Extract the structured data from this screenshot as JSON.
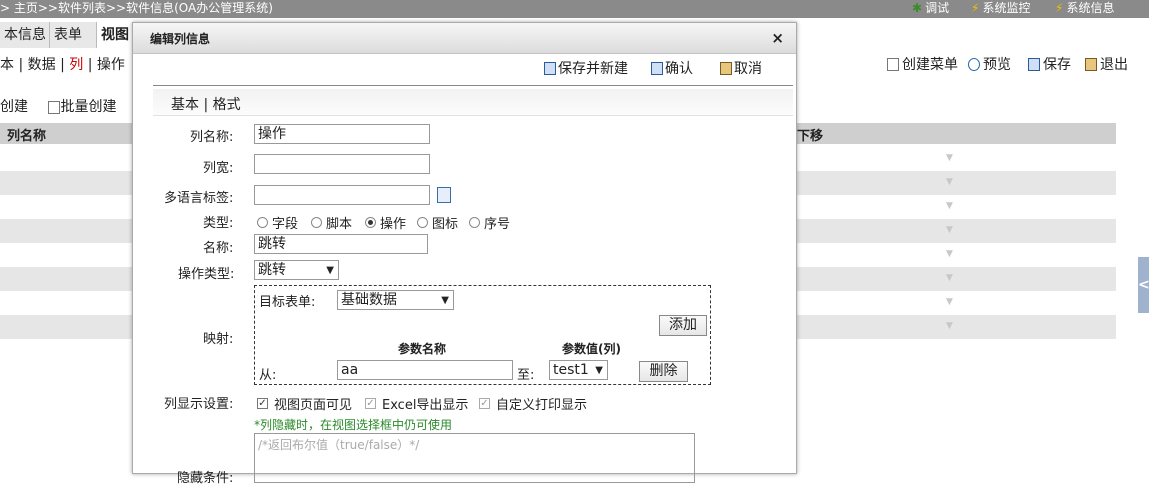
{
  "topbar": {
    "breadcrumb": "> 主页>>软件列表>>软件信息(OA办公管理系统)",
    "tools": [
      "调试",
      "系统监控",
      "系统信息"
    ]
  },
  "tabs": [
    "本信息",
    "表单",
    "视图"
  ],
  "subnav": {
    "a": "本",
    "b": "数据",
    "c": "列",
    "d": "操作"
  },
  "right_toolbar": [
    "创建菜单",
    "预览",
    "保存",
    "退出"
  ],
  "creates": {
    "single": "创建",
    "batch": "批量创建"
  },
  "grid": {
    "col_name": "列名称",
    "col_down": "下移",
    "row_count": 8
  },
  "modal": {
    "title": "编辑列信息",
    "close": "×",
    "buttons": {
      "save_new": "保存并新建",
      "confirm": "确认",
      "cancel": "取消"
    },
    "section": "基本 | 格式",
    "labels": {
      "col_name": "列名称:",
      "col_width": "列宽:",
      "lang_tag": "多语言标签:",
      "type": "类型:",
      "name": "名称:",
      "op_type": "操作类型:",
      "mapping": "映射:",
      "display": "列显示设置:",
      "hide_cond": "隐藏条件:"
    },
    "values": {
      "col_name": "操作",
      "col_width": "",
      "lang_tag": "",
      "name": "跳转",
      "op_type": "跳转"
    },
    "type_options": [
      "字段",
      "脚本",
      "操作",
      "图标",
      "序号"
    ],
    "type_selected": 2,
    "mapping": {
      "target_label": "目标表单:",
      "target_value": "基础数据",
      "add": "添加",
      "param_name_header": "参数名称",
      "param_value_header": "参数值(列)",
      "from": "从:",
      "from_value": "aa",
      "to": "至:",
      "to_value": "test1",
      "delete": "删除"
    },
    "display_options": [
      "视图页面可见",
      "Excel导出显示",
      "自定义打印显示"
    ],
    "display_note": "*列隐藏时，在视图选择框中仍可使用",
    "hide_placeholder": "/*返回布尔值（true/false）*/"
  },
  "icons": {
    "save": "save-icon",
    "confirm": "confirm-icon",
    "cancel": "cancel-icon",
    "lang": "language-edit-icon"
  }
}
